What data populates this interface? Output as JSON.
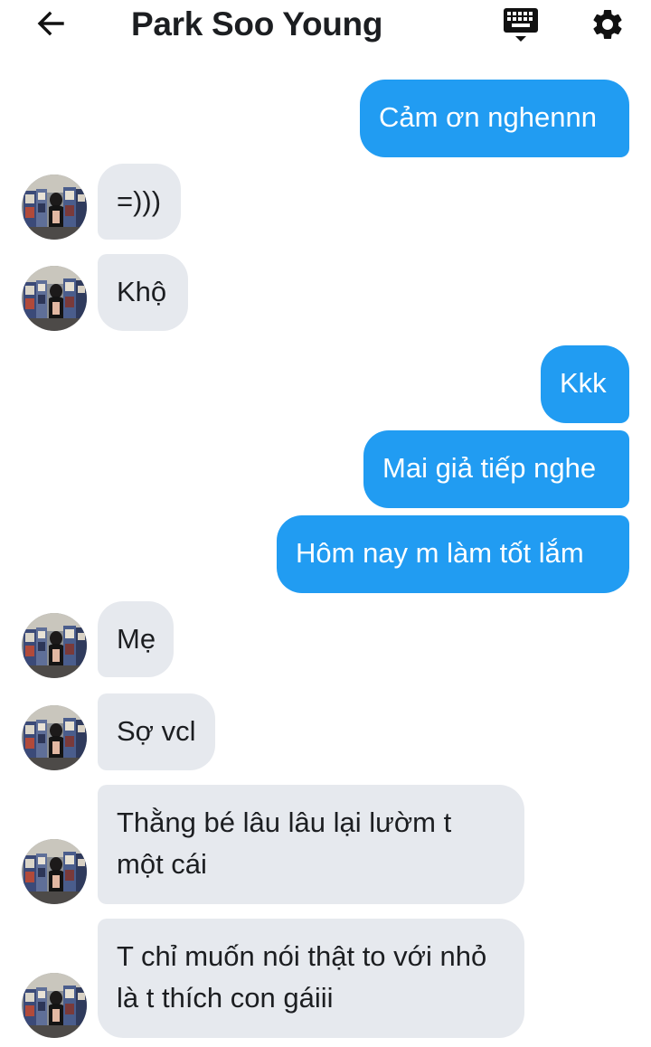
{
  "header": {
    "title": "Park Soo Young"
  },
  "messages": [
    {
      "side": "sent",
      "text": "Cảm ơn nghennn"
    },
    {
      "side": "recv",
      "text": "=)))"
    },
    {
      "side": "recv",
      "text": "Khộ"
    },
    {
      "side": "sent",
      "text": "Kkk"
    },
    {
      "side": "sent",
      "text": "Mai giả tiếp nghe"
    },
    {
      "side": "sent",
      "text": "Hôm nay m làm tốt lắm"
    },
    {
      "side": "recv",
      "text": "Mẹ"
    },
    {
      "side": "recv",
      "text": "Sợ vcl"
    },
    {
      "side": "recv",
      "text": "Thằng bé lâu lâu lại lườm t một cái"
    },
    {
      "side": "recv",
      "text": "T chỉ muốn nói thật to với nhỏ là t thích con gáiii"
    }
  ],
  "colors": {
    "sent_bubble": "#219cf2",
    "recv_bubble": "#e6e9ee"
  },
  "icons": [
    "back-arrow-icon",
    "keyboard-icon",
    "gear-icon",
    "contact-avatar"
  ]
}
